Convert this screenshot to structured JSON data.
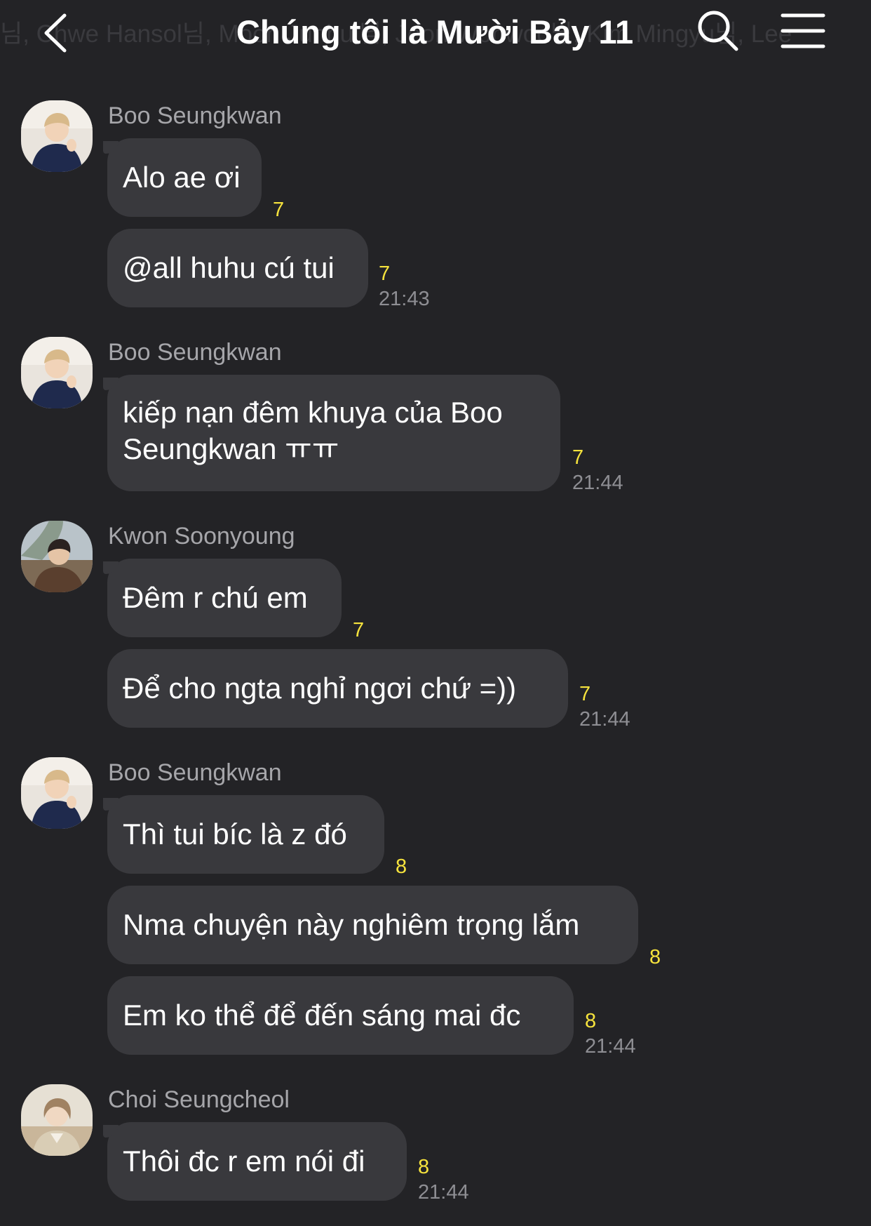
{
  "header": {
    "title": "Chúng tôi là Mười Bảy 11",
    "members_ghost": "님, Chwe Hansol님, Moon Junhui님, Jeon Wonwoo님, Kim Mingyu님, Lee"
  },
  "colors": {
    "background": "#232326",
    "bubble": "#39393d",
    "unread": "#f6e33d",
    "time": "#8e8e93",
    "sender": "#a6a6aa"
  },
  "messages": [
    {
      "sender": "Boo Seungkwan",
      "bubbles": [
        {
          "text": "Alo ae ơi",
          "unread": "7"
        },
        {
          "text": "@all huhu cú tui",
          "unread": "7",
          "time": "21:43"
        }
      ]
    },
    {
      "sender": "Boo Seungkwan",
      "bubbles": [
        {
          "text": "kiếp nạn đêm khuya của Boo Seungkwan ㅠㅠ",
          "unread": "7",
          "time": "21:44"
        }
      ]
    },
    {
      "sender": "Kwon Soonyoung",
      "bubbles": [
        {
          "text": "Đêm r chú em",
          "unread": "7"
        },
        {
          "text": "Để cho ngta nghỉ ngơi chứ =))",
          "unread": "7",
          "time": "21:44"
        }
      ]
    },
    {
      "sender": "Boo Seungkwan",
      "bubbles": [
        {
          "text": "Thì tui bíc là z đó",
          "unread": "8"
        },
        {
          "text": "Nma chuyện này nghiêm trọng lắm",
          "unread": "8"
        },
        {
          "text": "Em ko thể để đến sáng mai đc",
          "unread": "8",
          "time": "21:44"
        }
      ]
    },
    {
      "sender": "Choi Seungcheol",
      "bubbles": [
        {
          "text": "Thôi đc r em nói đi",
          "unread": "8",
          "time": "21:44"
        }
      ]
    }
  ]
}
